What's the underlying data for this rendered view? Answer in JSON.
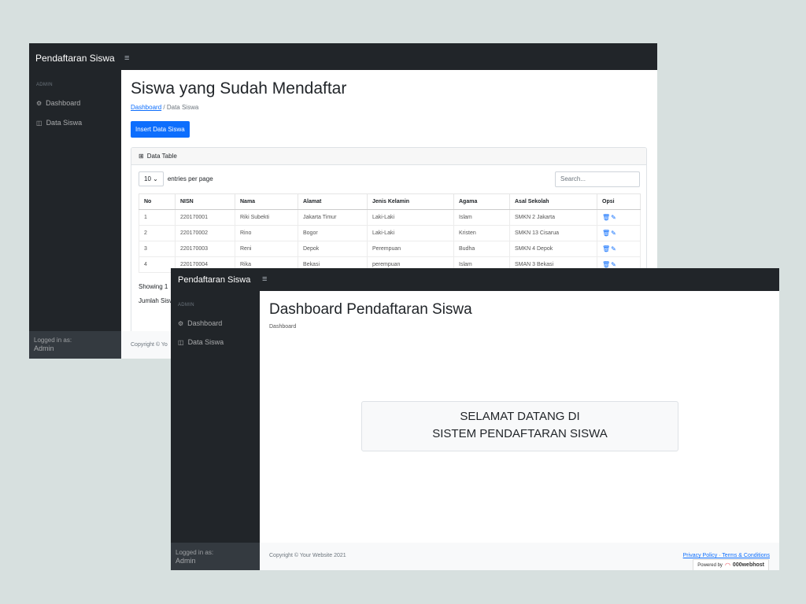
{
  "window1": {
    "brand": "Pendaftaran Siswa",
    "toggler_icon": "≡",
    "sidebar": {
      "heading": "ADMIN",
      "items": [
        {
          "icon": "⚙",
          "label": "Dashboard"
        },
        {
          "icon": "◫",
          "label": "Data Siswa"
        }
      ],
      "logged_in_label": "Logged in as:",
      "user": "Admin"
    },
    "title": "Siswa yang Sudah Mendaftar",
    "breadcrumb": {
      "link": "Dashboard",
      "sep": "/",
      "current": "Data Siswa"
    },
    "insert_button": "Insert Data Siswa",
    "card_title": "Data Table",
    "entries": {
      "value": "10 ⌄",
      "label": "entries per page"
    },
    "search_placeholder": "Search...",
    "table": {
      "headers": [
        "No",
        "NISN",
        "Nama",
        "Alamat",
        "Jenis Kelamin",
        "Agama",
        "Asal Sekolah",
        "Opsi"
      ],
      "rows": [
        [
          "1",
          "220170001",
          "Riki Subekti",
          "Jakarta Timur",
          "Laki-Laki",
          "Islam",
          "SMKN 2 Jakarta"
        ],
        [
          "2",
          "220170002",
          "Rino",
          "Bogor",
          "Laki-Laki",
          "Kristen",
          "SMKN 13 Cisarua"
        ],
        [
          "3",
          "220170003",
          "Reni",
          "Depok",
          "Perempuan",
          "Budha",
          "SMKN 4 Depok"
        ],
        [
          "4",
          "220170004",
          "Rika",
          "Bekasi",
          "perempuan",
          "Islam",
          "SMAN 3 Bekasi"
        ]
      ],
      "opsi_icons": "🗑✎"
    },
    "showing": "Showing 1",
    "jumlah": "Jumlah Sisw",
    "footer": "Copyright © Yo"
  },
  "window2": {
    "brand": "Pendaftaran Siswa",
    "toggler_icon": "≡",
    "sidebar": {
      "heading": "ADMIN",
      "items": [
        {
          "icon": "⚙",
          "label": "Dashboard"
        },
        {
          "icon": "◫",
          "label": "Data Siswa"
        }
      ],
      "logged_in_label": "Logged in as:",
      "user": "Admin"
    },
    "title": "Dashboard Pendaftaran Siswa",
    "breadcrumb": "Dashboard",
    "welcome_line1": "SELAMAT DATANG DI",
    "welcome_line2": "SISTEM PENDAFTARAN SISWA",
    "footer": {
      "copyright": "Copyright © Your Website 2021",
      "links": "Privacy Policy · Terms & Conditions",
      "powered_by": "Powered by",
      "host": "000webhost"
    }
  },
  "colors": {
    "dark": "#212529",
    "primary": "#0d6efd",
    "background": "#d7e0df"
  }
}
